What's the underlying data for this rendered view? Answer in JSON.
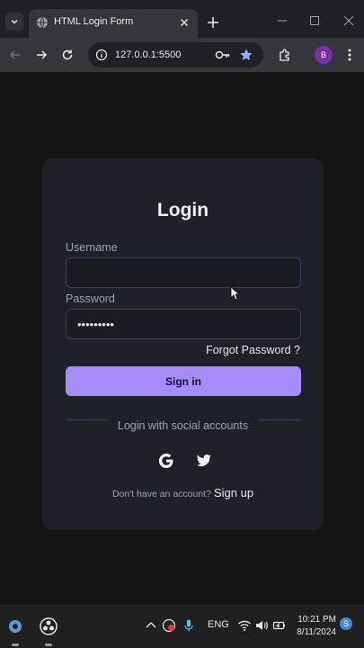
{
  "browser": {
    "tab_title": "HTML Login Form",
    "url": "127.0.0.1:5500",
    "profile_initial": "B"
  },
  "login": {
    "title": "Login",
    "username_label": "Username",
    "username_value": "",
    "password_label": "Password",
    "password_value": "•••••••••",
    "forgot_text": "Forgot Password ?",
    "signin_label": "Sign in",
    "social_text": "Login with social accounts",
    "social_icons": [
      "google-icon",
      "twitter-icon"
    ],
    "no_account_text": "Don't have an account?",
    "signup_text": "Sign up"
  },
  "colors": {
    "accent": "#a78bfa",
    "card_bg": "#1f2128",
    "page_bg": "#161616"
  },
  "taskbar": {
    "language": "ENG",
    "time": "10:21 PM",
    "date": "8/11/2024",
    "notification_badge": "S"
  }
}
